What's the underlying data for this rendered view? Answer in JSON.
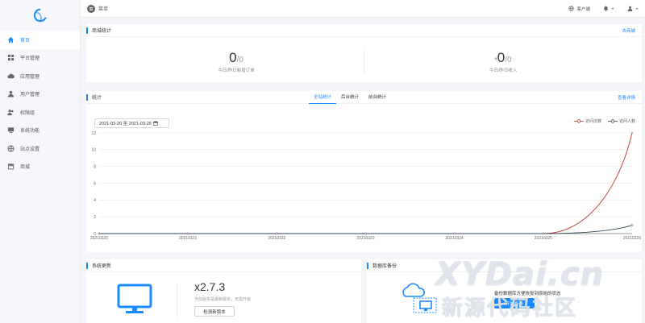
{
  "sidebar": {
    "items": [
      {
        "label": "首页",
        "icon": "home-icon",
        "active": true
      },
      {
        "label": "平台管理",
        "icon": "grid-icon"
      },
      {
        "label": "应用管理",
        "icon": "cloud-icon"
      },
      {
        "label": "用户管理",
        "icon": "user-icon"
      },
      {
        "label": "权限组",
        "icon": "user-group-icon"
      },
      {
        "label": "系统功能",
        "icon": "monitor-icon"
      },
      {
        "label": "站点设置",
        "icon": "globe-icon"
      },
      {
        "label": "商城",
        "icon": "store-icon"
      }
    ]
  },
  "topbar": {
    "menu_label": "菜单",
    "client_label": "客户端",
    "accent": "#1a8cff"
  },
  "mall_stats": {
    "title": "商城统计",
    "link": "去商城",
    "orders_value": "0",
    "orders_suffix": "/0",
    "orders_caption": "今日/昨日新增订单",
    "income_prefix": "¥",
    "income_value": "0",
    "income_suffix": "/0",
    "income_caption": "今日/昨日收入"
  },
  "stats": {
    "title": "统计",
    "tabs": [
      "全站统计",
      "后台统计",
      "前台统计"
    ],
    "active_tab": 0,
    "link": "查看详情",
    "date_range": "2021-03-20 至 2021-03-26"
  },
  "chart_data": {
    "type": "line",
    "x": [
      "20210320",
      "20210321",
      "20210322",
      "20210323",
      "20210324",
      "20210325",
      "20210326"
    ],
    "series": [
      {
        "name": "访问次数",
        "color": "#c23531",
        "values": [
          0,
          0,
          0,
          0,
          0,
          0,
          12
        ]
      },
      {
        "name": "访问人数",
        "color": "#2f4554",
        "values": [
          0,
          0,
          0,
          0,
          0,
          0,
          1
        ]
      }
    ],
    "y_ticks": [
      0,
      2,
      4,
      6,
      8,
      10,
      12
    ],
    "ylim": [
      0,
      12
    ],
    "grid": true,
    "legend": "top-right"
  },
  "system_update": {
    "title": "系统更新",
    "version": "x2.7.3",
    "subtitle": "当前版本是最新版本，无需升级",
    "check_button": "检测新版本"
  },
  "backup": {
    "title": "数据库备份",
    "text": "备份数据库方便恢复到原始的状态",
    "button": "开始备份"
  },
  "watermark": {
    "line1": "XYDai.cn",
    "line2": "新源代码社区"
  }
}
